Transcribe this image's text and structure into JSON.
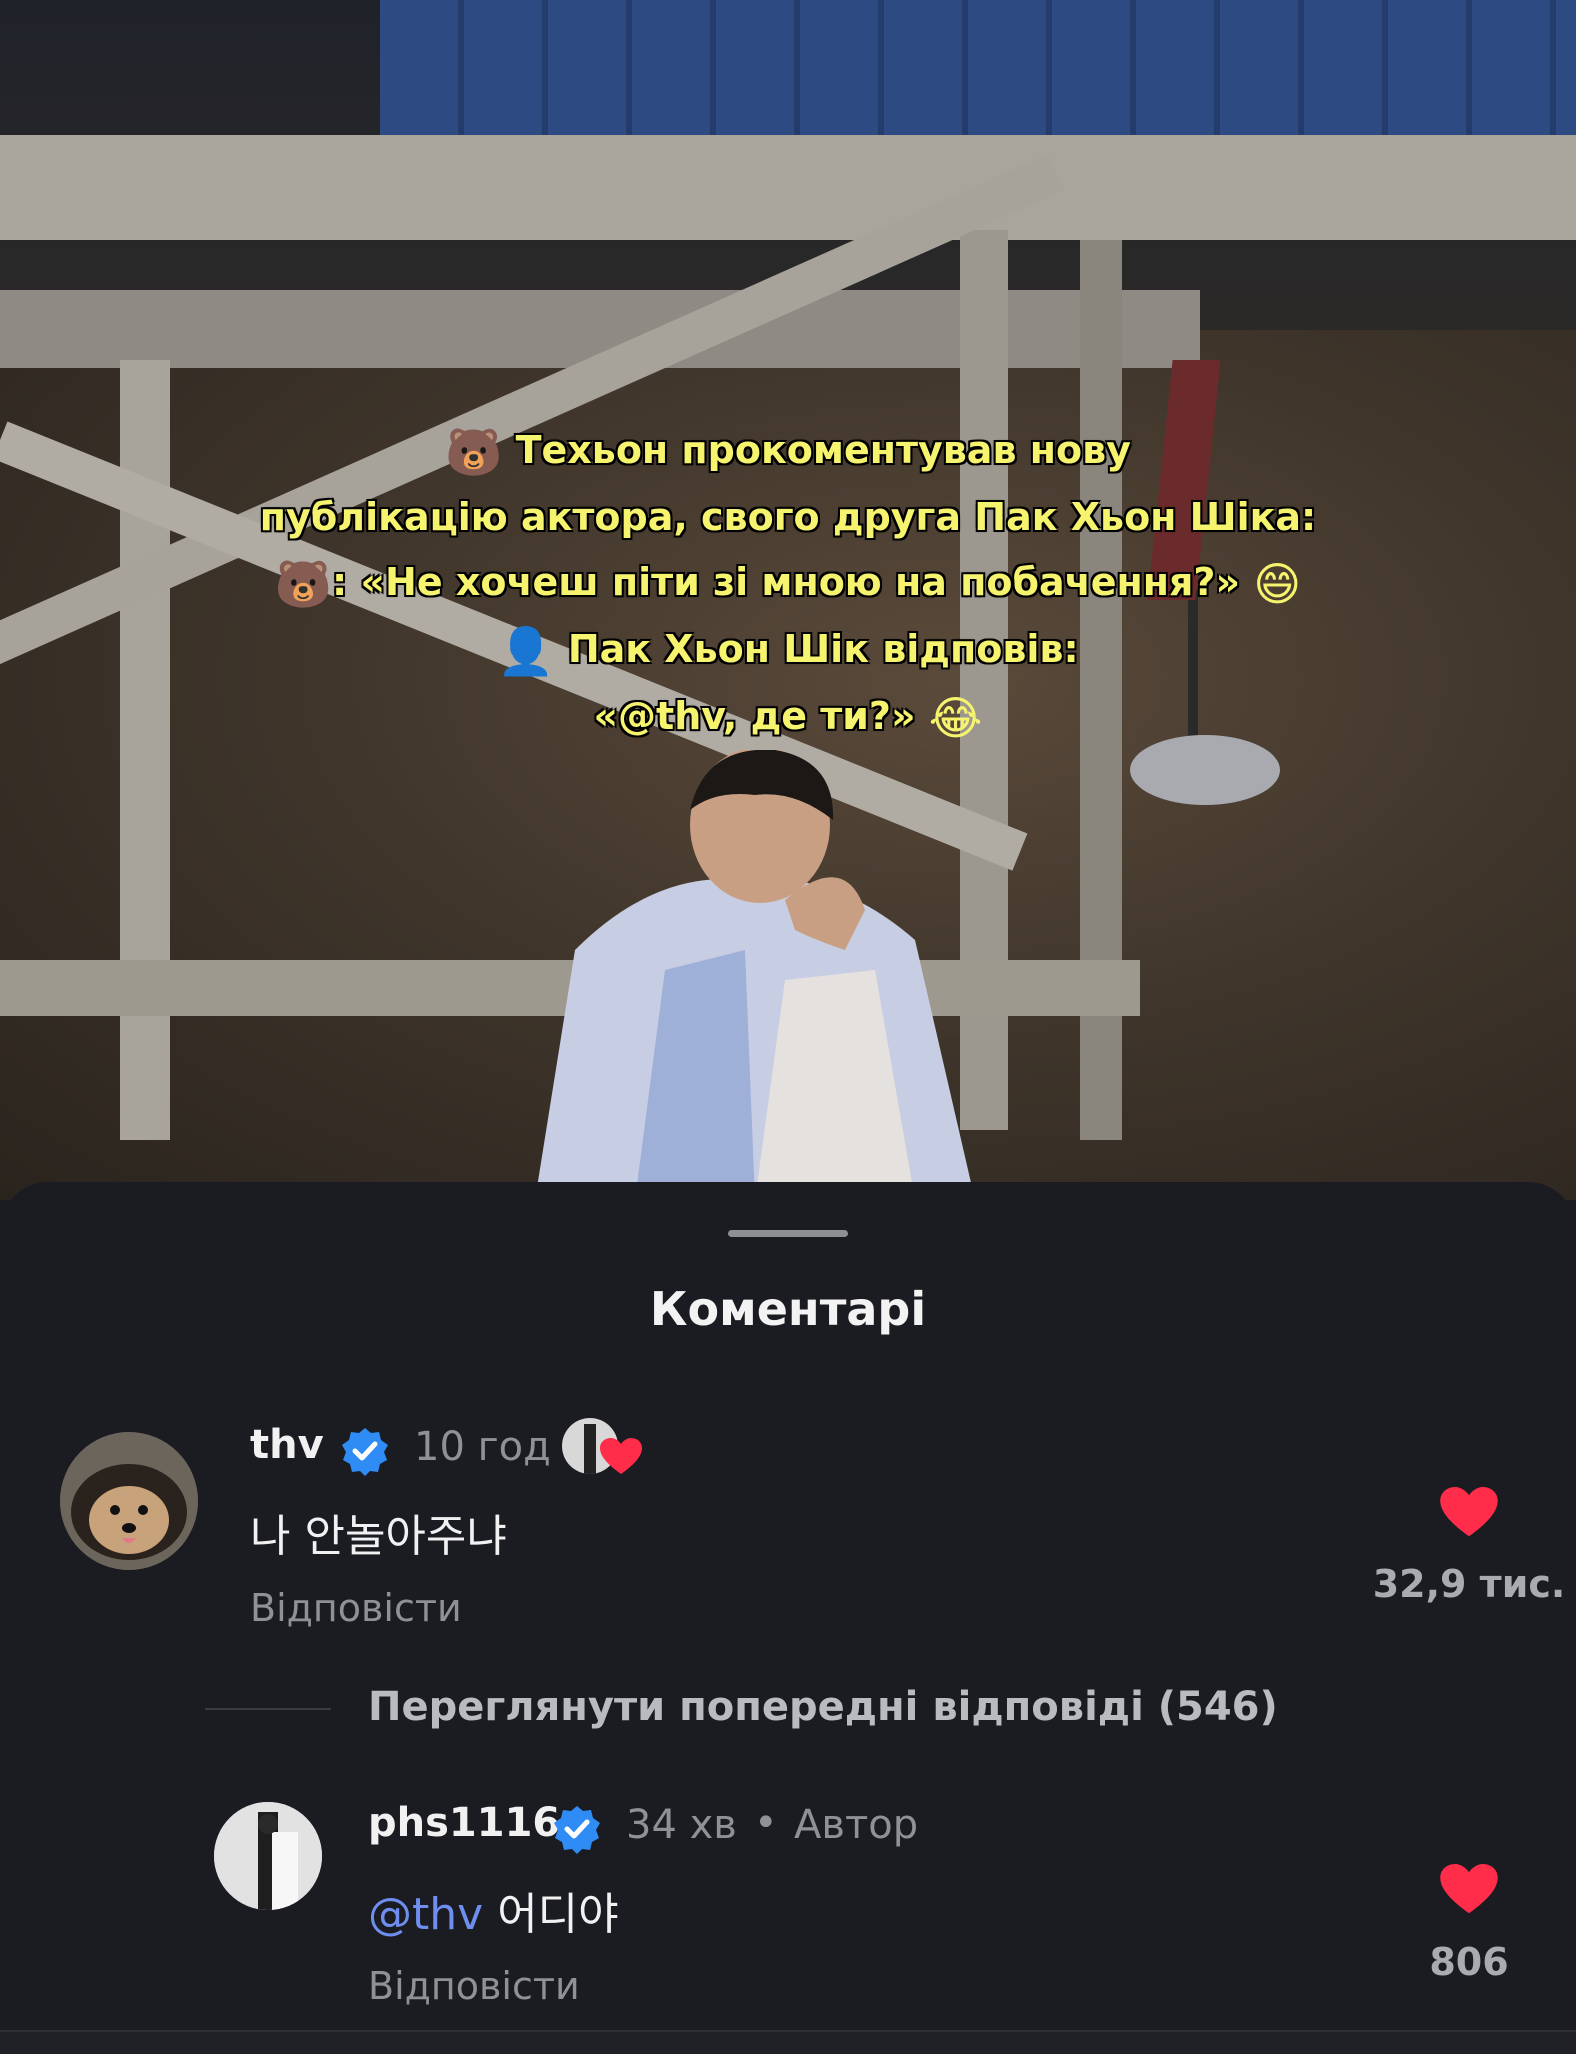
{
  "overlay": {
    "line1_emoji": "🐻",
    "line1": "Техьон прокоментував нову",
    "line2": "публікацію актора, свого друга  Пак Хьон Шіка:",
    "line3_emoji": "🐻",
    "line3": ": «Не хочеш піти зі мною на побачення?»",
    "line3_end_emoji": "😄",
    "line4_emoji": "👤",
    "line4": "Пак Хьон Шік відповів:",
    "line5": "«@thv, де ти?»",
    "line5_emoji": "😂"
  },
  "sheet": {
    "title": "Коментарі"
  },
  "comments": [
    {
      "username": "thv",
      "time": "10 год",
      "text": "나 안놀아주냐",
      "reply_label": "Відповісти",
      "likes": "32,9 тис."
    },
    {
      "username": "phs1116",
      "time": "34 хв",
      "separator": "•",
      "author_badge": "Автор",
      "mention": "@thv",
      "text": "어디야",
      "reply_label": "Відповісти",
      "likes": "806"
    }
  ],
  "view_replies": "Переглянути попередні відповіді (546)",
  "colors": {
    "sheet_bg": "#1a1c21",
    "overlay_text": "#f6f36e",
    "heart": "#ff2d49",
    "verified": "#2f8cf5",
    "mention": "#6f8ff0"
  },
  "icons": [
    "verified-badge-icon",
    "heart-icon",
    "creator-liked-icon"
  ]
}
